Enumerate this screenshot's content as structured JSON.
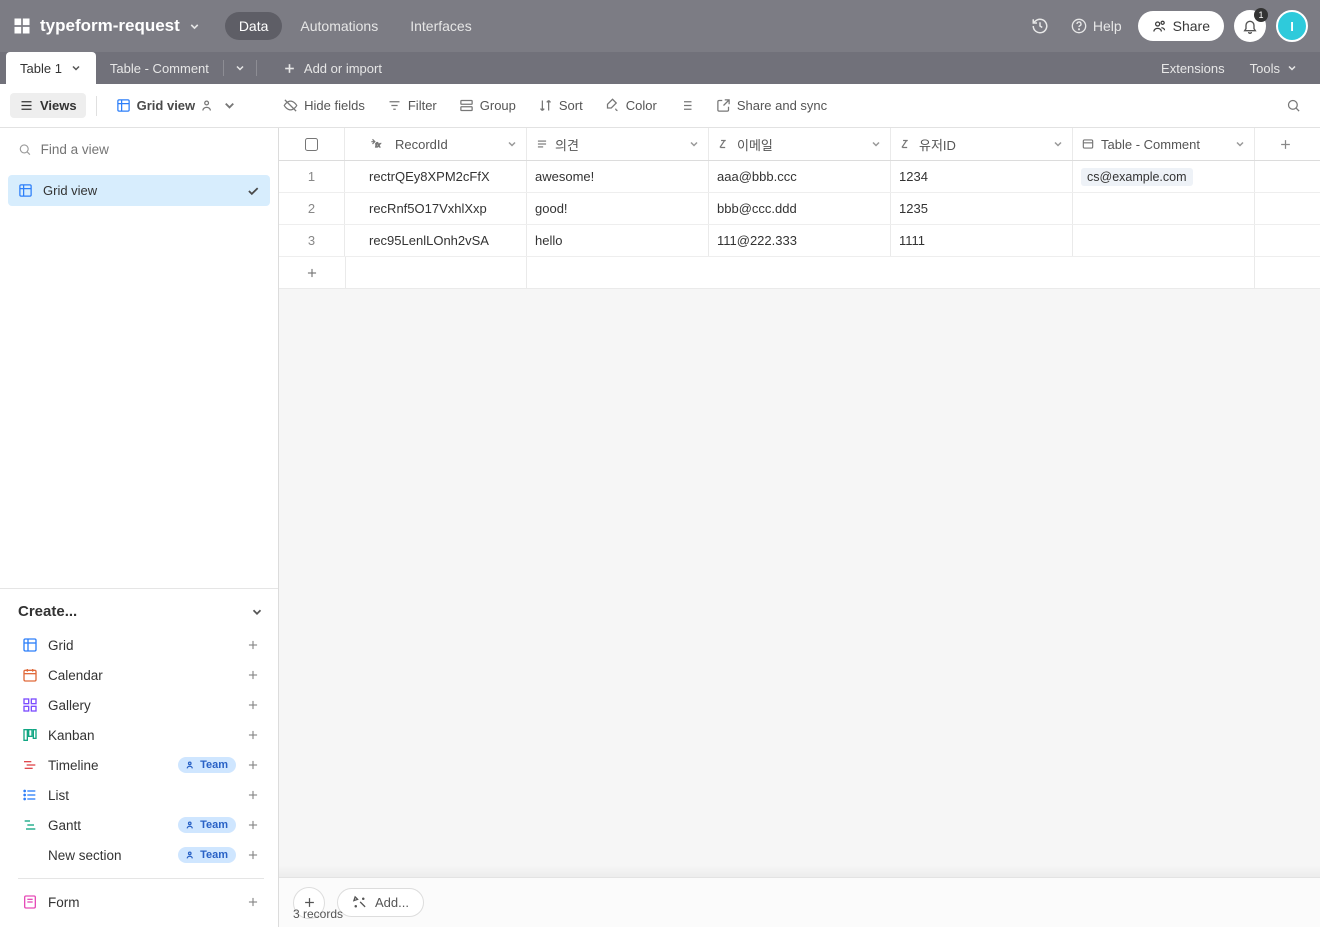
{
  "header": {
    "base_name": "typeform-request",
    "nav": {
      "data": "Data",
      "automations": "Automations",
      "interfaces": "Interfaces"
    },
    "help_label": "Help",
    "share_label": "Share",
    "notification_count": "1",
    "avatar_initial": "I"
  },
  "tabsbar": {
    "tabs": [
      {
        "name": "Table 1",
        "active": true
      },
      {
        "name": "Table - Comment",
        "active": false
      }
    ],
    "add_import": "Add or import",
    "extensions": "Extensions",
    "tools": "Tools"
  },
  "toolbar": {
    "views": "Views",
    "grid_view": "Grid view",
    "hide_fields": "Hide fields",
    "filter": "Filter",
    "group": "Group",
    "sort": "Sort",
    "color": "Color",
    "share_sync": "Share and sync"
  },
  "sidebar": {
    "find_placeholder": "Find a view",
    "active_view": "Grid view",
    "create_label": "Create...",
    "create_items": [
      {
        "key": "grid",
        "label": "Grid",
        "color": "#2d7ff9",
        "team": false
      },
      {
        "key": "calendar",
        "label": "Calendar",
        "color": "#e06a3b",
        "team": false
      },
      {
        "key": "gallery",
        "label": "Gallery",
        "color": "#7c4dff",
        "team": false
      },
      {
        "key": "kanban",
        "label": "Kanban",
        "color": "#11a683",
        "team": false
      },
      {
        "key": "timeline",
        "label": "Timeline",
        "color": "#e0484d",
        "team": true
      },
      {
        "key": "list",
        "label": "List",
        "color": "#2d7ff9",
        "team": false
      },
      {
        "key": "gantt",
        "label": "Gantt",
        "color": "#11a683",
        "team": true
      },
      {
        "key": "section",
        "label": "New section",
        "color": "#555",
        "team": true
      }
    ],
    "team_pill": "Team",
    "form_label": "Form"
  },
  "grid": {
    "columns": [
      {
        "key": "recordid",
        "label": "RecordId"
      },
      {
        "key": "opinion",
        "label": "의견"
      },
      {
        "key": "email",
        "label": "이메일"
      },
      {
        "key": "userid",
        "label": "유저ID"
      },
      {
        "key": "comment",
        "label": "Table - Comment"
      }
    ],
    "rows": [
      {
        "n": "1",
        "recordid": "rectrQEy8XPM2cFfX",
        "opinion": "awesome!",
        "email": "aaa@bbb.ccc",
        "userid": "1234",
        "comment": "cs@example.com"
      },
      {
        "n": "2",
        "recordid": "recRnf5O17VxhlXxp",
        "opinion": "good!",
        "email": "bbb@ccc.ddd",
        "userid": "1235",
        "comment": ""
      },
      {
        "n": "3",
        "recordid": "rec95LenlLOnh2vSA",
        "opinion": "hello",
        "email": "111@222.333",
        "userid": "1111",
        "comment": ""
      }
    ],
    "footer_add": "Add...",
    "record_count": "3 records"
  }
}
